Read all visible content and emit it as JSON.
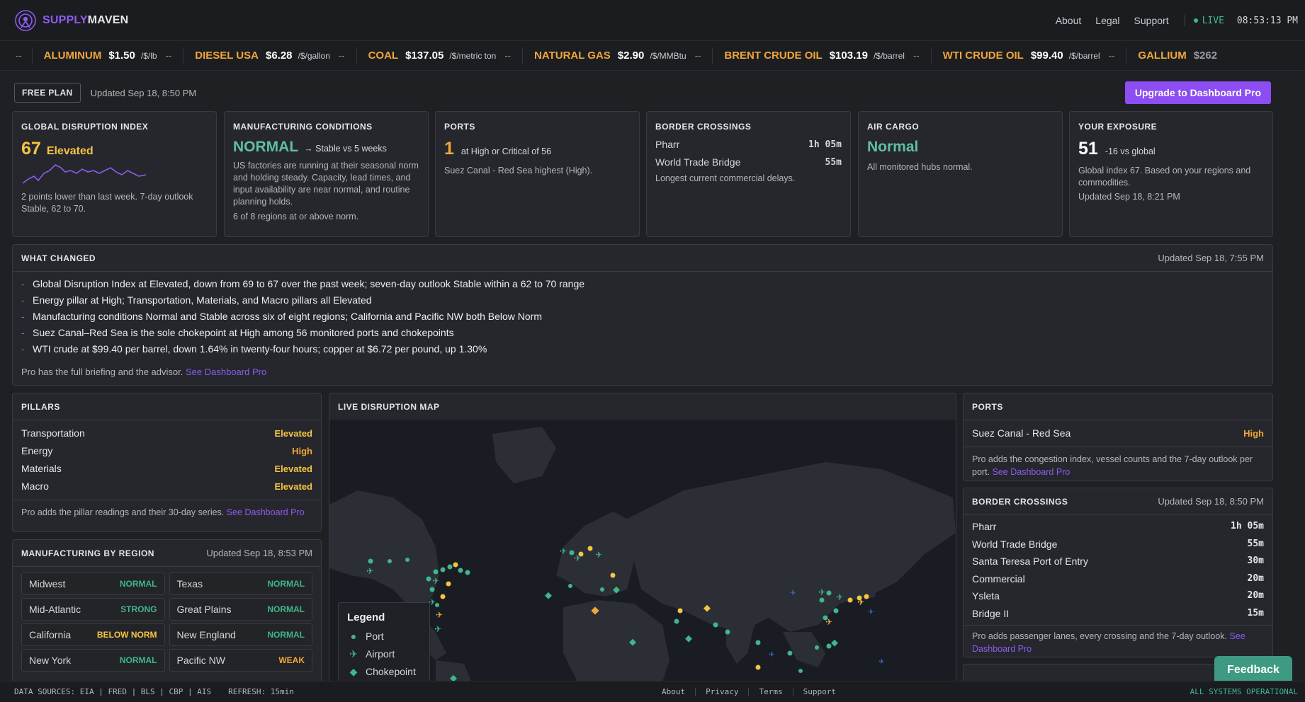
{
  "header": {
    "brand_part1": "SUPPLY",
    "brand_part2": "MAVEN",
    "nav": [
      "About",
      "Legal",
      "Support"
    ],
    "live_label": "LIVE",
    "clock": "08:53:13 PM"
  },
  "ticker": {
    "lead": "--",
    "items": [
      {
        "name": "ALUMINUM",
        "price": "$1.50",
        "unit": "/$/lb",
        "change": "--"
      },
      {
        "name": "DIESEL USA",
        "price": "$6.28",
        "unit": "/$/gallon",
        "change": "--"
      },
      {
        "name": "COAL",
        "price": "$137.05",
        "unit": "/$/metric ton",
        "change": "--"
      },
      {
        "name": "NATURAL GAS",
        "price": "$2.90",
        "unit": "/$/MMBtu",
        "change": "--"
      },
      {
        "name": "BRENT CRUDE OIL",
        "price": "$103.19",
        "unit": "/$/barrel",
        "change": "--"
      },
      {
        "name": "WTI CRUDE OIL",
        "price": "$99.40",
        "unit": "/$/barrel",
        "change": "--"
      },
      {
        "name": "GALLIUM",
        "price": "$262",
        "unit": "",
        "change": ""
      }
    ]
  },
  "plan": {
    "badge": "FREE PLAN",
    "updated": "Updated Sep 18, 8:50 PM",
    "upgrade": "Upgrade to Dashboard Pro"
  },
  "cards": {
    "gdi": {
      "title": "GLOBAL DISRUPTION INDEX",
      "value": "67",
      "level": "Elevated",
      "desc": "2 points lower than last week. 7-day outlook Stable, 62 to 70."
    },
    "mfg": {
      "title": "MANUFACTURING CONDITIONS",
      "value": "NORMAL",
      "trend": "→ Stable vs 5 weeks",
      "desc": "US factories are running at their seasonal norm and holding steady. Capacity, lead times, and input availability are near normal, and routine planning holds.",
      "foot": "6 of 8 regions at or above norm."
    },
    "ports": {
      "title": "PORTS",
      "value": "1",
      "sub": "at High or Critical of 56",
      "desc": "Suez Canal - Red Sea highest (High)."
    },
    "border": {
      "title": "BORDER CROSSINGS",
      "rows": [
        {
          "name": "Pharr",
          "time": "1h 05m"
        },
        {
          "name": "World Trade Bridge",
          "time": "55m"
        }
      ],
      "desc": "Longest current commercial delays."
    },
    "air": {
      "title": "AIR CARGO",
      "value": "Normal",
      "desc": "All monitored hubs normal."
    },
    "exposure": {
      "title": "YOUR EXPOSURE",
      "value": "51",
      "sub": "-16 vs global",
      "desc": "Global index 67. Based on your regions and commodities.",
      "updated": "Updated Sep 18, 8:21 PM"
    }
  },
  "what_changed": {
    "title": "WHAT CHANGED",
    "updated": "Updated Sep 18, 7:55 PM",
    "bullets": [
      "Global Disruption Index at Elevated, down from 69 to 67 over the past week; seven-day outlook Stable within a 62 to 70 range",
      "Energy pillar at High; Transportation, Materials, and Macro pillars all Elevated",
      "Manufacturing conditions Normal and Stable across six of eight regions; California and Pacific NW both Below Norm",
      "Suez Canal–Red Sea is the sole chokepoint at High among 56 monitored ports and chokepoints",
      "WTI crude at $99.40 per barrel, down 1.64% in twenty-four hours; copper at $6.72 per pound, up 1.30%"
    ],
    "pro_note": "Pro has the full briefing and the advisor.",
    "pro_link": "See Dashboard Pro"
  },
  "pillars": {
    "title": "PILLARS",
    "rows": [
      {
        "name": "Transportation",
        "level": "Elevated",
        "color": "#f5c542"
      },
      {
        "name": "Energy",
        "level": "High",
        "color": "#f0a63a"
      },
      {
        "name": "Materials",
        "level": "Elevated",
        "color": "#f5c542"
      },
      {
        "name": "Macro",
        "level": "Elevated",
        "color": "#f5c542"
      }
    ],
    "pro_note": "Pro adds the pillar readings and their 30-day series.",
    "pro_link": "See Dashboard Pro"
  },
  "regions": {
    "title": "MANUFACTURING BY REGION",
    "updated": "Updated Sep 18, 8:53 PM",
    "cells": [
      {
        "name": "Midwest",
        "status": "NORMAL",
        "color": "#3fb68b"
      },
      {
        "name": "Texas",
        "status": "NORMAL",
        "color": "#3fb68b"
      },
      {
        "name": "Mid-Atlantic",
        "status": "STRONG",
        "color": "#3fb68b"
      },
      {
        "name": "Great Plains",
        "status": "NORMAL",
        "color": "#3fb68b"
      },
      {
        "name": "California",
        "status": "BELOW NORM",
        "color": "#f5c542"
      },
      {
        "name": "New England",
        "status": "NORMAL",
        "color": "#3fb68b"
      },
      {
        "name": "New York",
        "status": "NORMAL",
        "color": "#3fb68b"
      },
      {
        "name": "Pacific NW",
        "status": "WEAK",
        "color": "#f0a63a"
      }
    ]
  },
  "map": {
    "title": "LIVE DISRUPTION MAP",
    "legend_title": "Legend",
    "legend": [
      {
        "label": "Port",
        "icon": "circle-icon"
      },
      {
        "label": "Airport",
        "icon": "plane-icon"
      },
      {
        "label": "Chokepoint",
        "icon": "diamond-icon"
      }
    ]
  },
  "ports_panel": {
    "title": "PORTS",
    "row": {
      "name": "Suez Canal - Red Sea",
      "level": "High"
    },
    "pro_note": "Pro adds the congestion index, vessel counts and the 7-day outlook per port.",
    "pro_link": "See Dashboard Pro"
  },
  "border_panel": {
    "title": "BORDER CROSSINGS",
    "updated": "Updated Sep 18, 8:50 PM",
    "rows": [
      {
        "name": "Pharr",
        "time": "1h 05m"
      },
      {
        "name": "World Trade Bridge",
        "time": "55m"
      },
      {
        "name": "Santa Teresa Port of Entry",
        "time": "30m"
      },
      {
        "name": "Commercial",
        "time": "20m"
      },
      {
        "name": "Ysleta",
        "time": "20m"
      },
      {
        "name": "Bridge II",
        "time": "15m"
      }
    ],
    "pro_note": "Pro adds passenger lanes, every crossing and the 7-day outlook.",
    "pro_link": "See Dashboard Pro"
  },
  "footer": {
    "sources": "DATA SOURCES: EIA | FRED | BLS | CBP | AIS",
    "refresh": "REFRESH: 15min",
    "links": [
      "About",
      "Privacy",
      "Terms",
      "Support"
    ],
    "status": "ALL SYSTEMS OPERATIONAL"
  },
  "feedback": "Feedback"
}
